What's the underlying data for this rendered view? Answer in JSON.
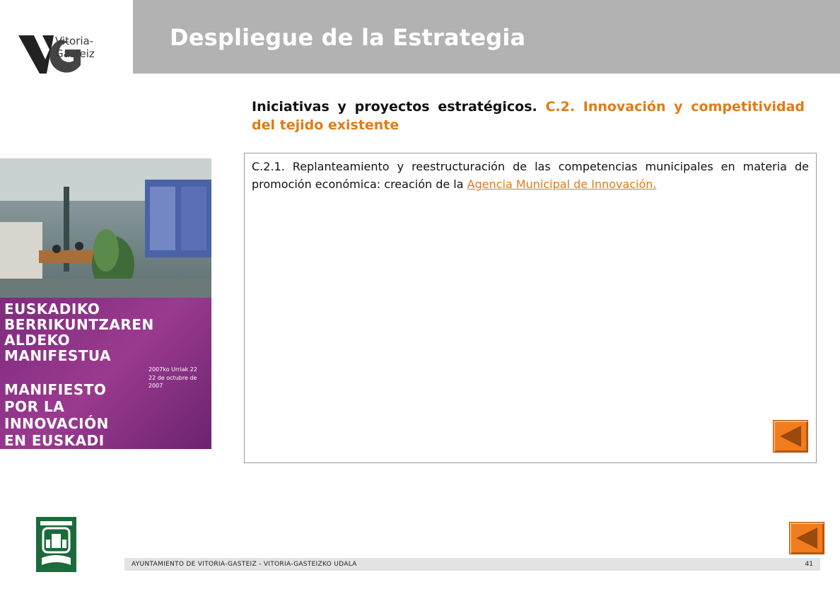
{
  "logo": {
    "text": "Vitoria-Gasteiz",
    "mark": "VG",
    "icon": "vitoria-gasteiz-logo"
  },
  "header": {
    "title": "Despliegue de la Estrategia"
  },
  "subtitle": {
    "part1": "Iniciativas y proyectos estratégicos.",
    "part2": "C.2. Innovación y competitividad del tejido existente"
  },
  "images": {
    "photo": "office-interior-photo",
    "poster": {
      "lines": [
        "EUSKADIKO",
        "BERRIKUNTZAREN",
        "ALDEKO",
        "MANIFESTUA",
        "MANIFIESTO",
        "POR LA",
        "INNOVACIÓN",
        "EN EUSKADI"
      ],
      "date_line1": "2007ko Urriak 22",
      "date_line2": "22 de octubre de 2007"
    }
  },
  "content": {
    "text": "C.2.1. Replanteamiento y reestructuración de las competencias municipales en materia de promoción económica: creación de la ",
    "link": "Agencia Municipal de Innovación."
  },
  "navigation": {
    "back_icon": "triangle-left-icon"
  },
  "footer": {
    "emblem": "city-coat-of-arms",
    "text": "AYUNTAMIENTO DE VITORIA-GASTEIZ - VITORIA-GASTEIZKO UDALA",
    "page": "41"
  },
  "colors": {
    "accent": "#e07b18",
    "header_bg": "#b2b2b2",
    "poster_bg": "#8b3186",
    "emblem_bg": "#1d6a3a"
  }
}
